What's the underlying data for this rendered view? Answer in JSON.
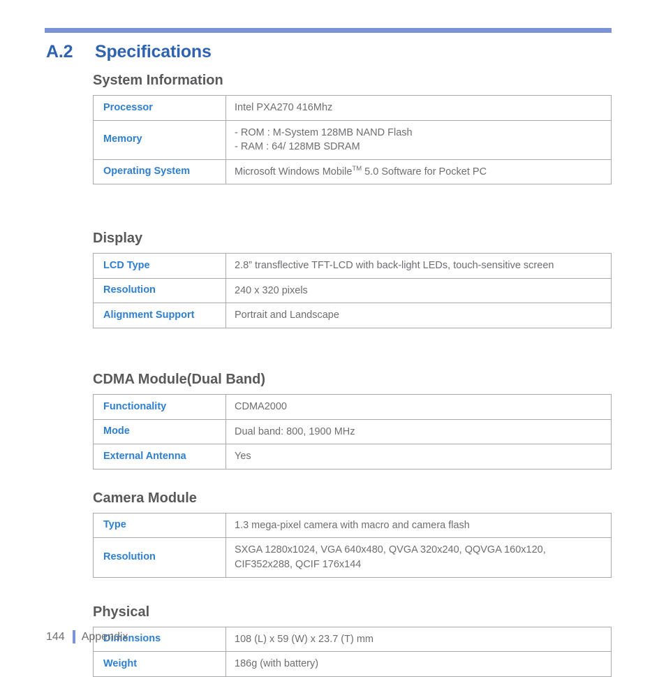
{
  "document": {
    "chapter_number": "A.2",
    "chapter_title": "Specifications",
    "accent_rule_color": "#7a94d4",
    "title_color": "#2f63b0",
    "label_color": "#2f7fd0",
    "value_color": "#6d6e71",
    "heading_color": "#58595b"
  },
  "sections": [
    {
      "heading": "System Information",
      "rows": [
        {
          "label": "Processor",
          "lines": [
            "Intel PXA270 416Mhz"
          ]
        },
        {
          "label": "Memory",
          "lines": [
            "- ROM : M-System 128MB NAND Flash",
            "- RAM : 64/ 128MB SDRAM"
          ]
        },
        {
          "label": "Operating System",
          "lines": [
            "Microsoft Windows Mobile™ 5.0 Software for Pocket PC"
          ],
          "has_tm": true,
          "tm_before": "Microsoft Windows Mobile",
          "tm_after": " 5.0 Software for Pocket PC"
        }
      ]
    },
    {
      "heading": "Display",
      "rows": [
        {
          "label": "LCD Type",
          "lines": [
            "2.8” transflective TFT-LCD with back-light LEDs, touch-sensitive screen"
          ]
        },
        {
          "label": "Resolution",
          "lines": [
            "240 x 320 pixels"
          ]
        },
        {
          "label": "Alignment Support",
          "lines": [
            "Portrait and Landscape"
          ]
        }
      ]
    },
    {
      "heading": "CDMA Module(Dual Band)",
      "rows": [
        {
          "label": "Functionality",
          "lines": [
            "CDMA2000"
          ]
        },
        {
          "label": "Mode",
          "lines": [
            "Dual band: 800, 1900 MHz"
          ]
        },
        {
          "label": "External Antenna",
          "lines": [
            "Yes"
          ]
        }
      ]
    },
    {
      "heading": "Camera Module",
      "rows": [
        {
          "label": "Type",
          "lines": [
            "1.3 mega-pixel camera with macro and camera flash"
          ]
        },
        {
          "label": "Resolution",
          "lines": [
            "SXGA 1280x1024, VGA 640x480, QVGA 320x240, QQVGA 160x120,",
            "CIF352x288, QCIF 176x144"
          ]
        }
      ]
    },
    {
      "heading": "Physical",
      "rows": [
        {
          "label": "Dimensions",
          "lines": [
            "108 (L) x 59 (W) x 23.7 (T) mm"
          ]
        },
        {
          "label": "Weight",
          "lines": [
            "186g (with battery)"
          ]
        }
      ]
    }
  ],
  "footer": {
    "page_number": "144",
    "label": "Appendix"
  }
}
